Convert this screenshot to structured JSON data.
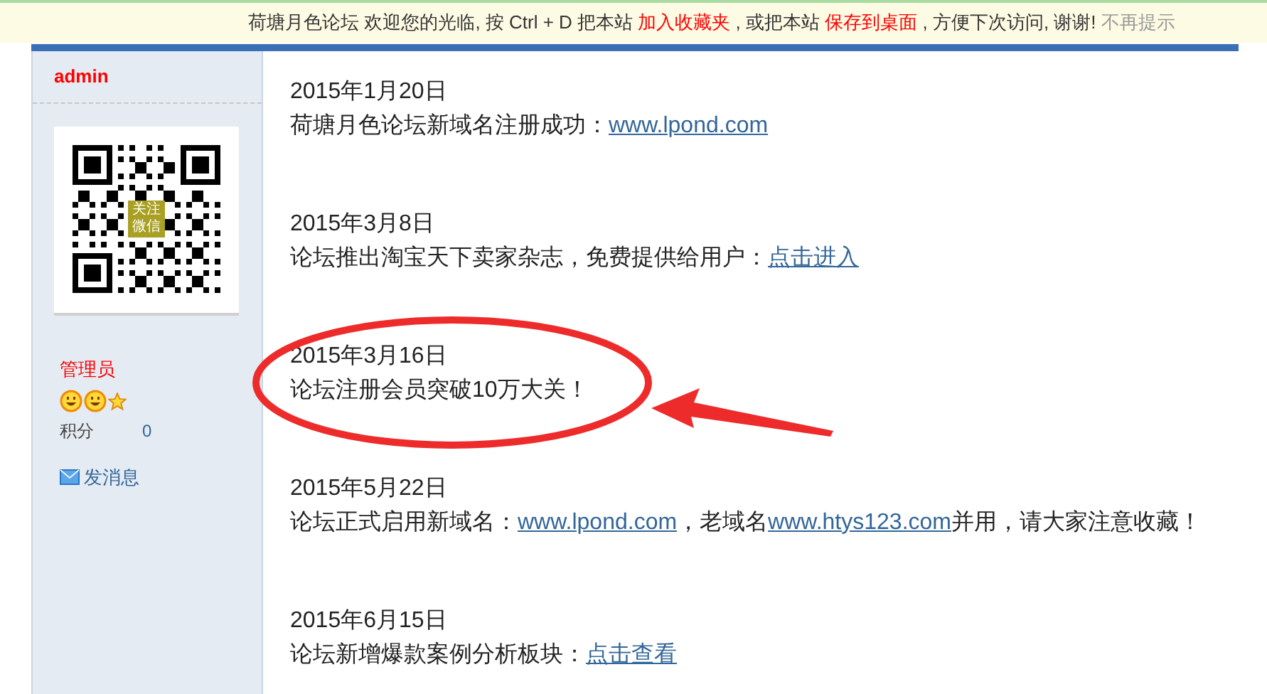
{
  "notice_bar": {
    "segments": [
      {
        "kind": "plain",
        "text": "荷塘月色论坛 欢迎您的光临, 按 Ctrl + D 把本站 "
      },
      {
        "kind": "highlight",
        "text": "加入收藏夹"
      },
      {
        "kind": "plain",
        "text": " , 或把本站 "
      },
      {
        "kind": "highlight",
        "text": "保存到桌面"
      },
      {
        "kind": "plain",
        "text": " , 方便下次访问, 谢谢! "
      },
      {
        "kind": "dismiss",
        "text": "不再提示"
      }
    ]
  },
  "sidebar": {
    "username": "admin",
    "qr_label": "关注微信",
    "rank": "管理员",
    "points_label": "积分",
    "points_value": "0",
    "message_link": "发消息"
  },
  "posts": [
    {
      "date": "2015年1月20日",
      "segments": [
        {
          "kind": "plain",
          "text": "荷塘月色论坛新域名注册成功："
        },
        {
          "kind": "link",
          "text": "www.lpond.com"
        }
      ],
      "circled": false
    },
    {
      "date": "2015年3月8日",
      "segments": [
        {
          "kind": "plain",
          "text": "论坛推出淘宝天下卖家杂志，免费提供给用户："
        },
        {
          "kind": "link",
          "text": "点击进入"
        }
      ],
      "circled": false
    },
    {
      "date": "2015年3月16日",
      "segments": [
        {
          "kind": "plain",
          "text": "论坛注册会员突破10万大关！"
        }
      ],
      "circled": true
    },
    {
      "date": "2015年5月22日",
      "segments": [
        {
          "kind": "plain",
          "text": "论坛正式启用新域名："
        },
        {
          "kind": "link",
          "text": "www.lpond.com"
        },
        {
          "kind": "plain",
          "text": "，老域名"
        },
        {
          "kind": "link",
          "text": "www.htys123.com"
        },
        {
          "kind": "plain",
          "text": "并用，请大家注意收藏！"
        }
      ],
      "circled": false
    },
    {
      "date": "2015年6月15日",
      "segments": [
        {
          "kind": "plain",
          "text": "论坛新增爆款案例分析板块："
        },
        {
          "kind": "link",
          "text": "点击查看"
        }
      ],
      "circled": false
    }
  ]
}
